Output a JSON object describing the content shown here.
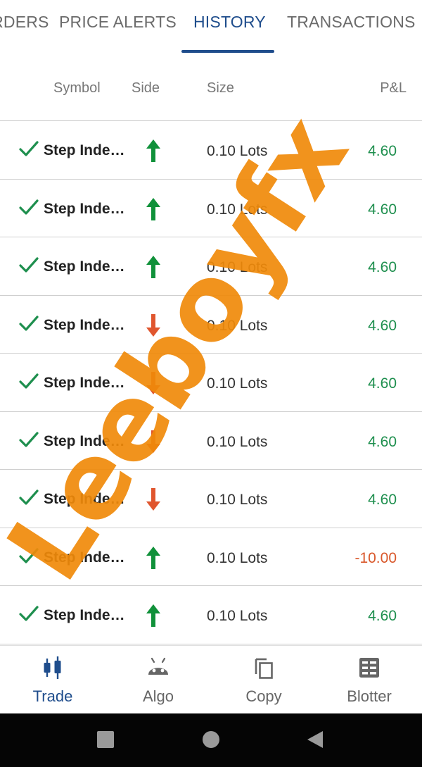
{
  "tabs": [
    {
      "label": "ORDERS"
    },
    {
      "label": "PRICE ALERTS"
    },
    {
      "label": "HISTORY",
      "active": true
    },
    {
      "label": "TRANSACTIONS"
    }
  ],
  "columns": {
    "symbol": "Symbol",
    "side": "Side",
    "size": "Size",
    "pnl": "P&L"
  },
  "rows": [
    {
      "status_icon": "check-icon",
      "symbol": "Step Inde…",
      "side": "buy",
      "size": "0.10 Lots",
      "pnl": "4.60"
    },
    {
      "status_icon": "check-icon",
      "symbol": "Step Inde…",
      "side": "buy",
      "size": "0.10 Lots",
      "pnl": "4.60"
    },
    {
      "status_icon": "check-icon",
      "symbol": "Step Inde…",
      "side": "buy",
      "size": "0.10 Lots",
      "pnl": "4.60"
    },
    {
      "status_icon": "check-icon",
      "symbol": "Step Inde…",
      "side": "sell",
      "size": "0.10 Lots",
      "pnl": "4.60"
    },
    {
      "status_icon": "check-icon",
      "symbol": "Step Inde…",
      "side": "sell",
      "size": "0.10 Lots",
      "pnl": "4.60"
    },
    {
      "status_icon": "check-icon",
      "symbol": "Step Inde…",
      "side": "sell",
      "size": "0.10 Lots",
      "pnl": "4.60"
    },
    {
      "status_icon": "check-icon",
      "symbol": "Step Inde…",
      "side": "sell",
      "size": "0.10 Lots",
      "pnl": "4.60"
    },
    {
      "status_icon": "check-icon",
      "symbol": "Step Inde…",
      "side": "buy",
      "size": "0.10 Lots",
      "pnl": "-10.00"
    },
    {
      "status_icon": "check-icon",
      "symbol": "Step Inde…",
      "side": "buy",
      "size": "0.10 Lots",
      "pnl": "4.60"
    }
  ],
  "bottom_nav": [
    {
      "label": "Trade",
      "icon": "candlestick-icon",
      "active": true
    },
    {
      "label": "Algo",
      "icon": "robot-icon"
    },
    {
      "label": "Copy",
      "icon": "copy-icon"
    },
    {
      "label": "Blotter",
      "icon": "blotter-icon"
    }
  ],
  "system_nav": [
    "recents-button",
    "home-button",
    "back-button"
  ],
  "watermark": "Leeboyfx",
  "colors": {
    "accent": "#1f4d8c",
    "profit": "#1e8f4e",
    "loss": "#d9582b",
    "buy_arrow": "#10913a",
    "sell_arrow": "#e0562e",
    "check": "#1e8f4e",
    "watermark": "#f08a0a"
  }
}
